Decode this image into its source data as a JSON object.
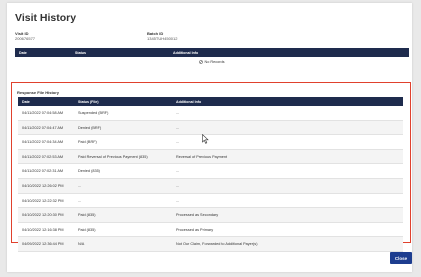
{
  "modal": {
    "title": "Visit History"
  },
  "meta": {
    "visit_id_label": "Visit ID",
    "visit_id": "200676577",
    "batch_id_label": "Batch ID",
    "batch_id": "1345TUH450012"
  },
  "top_table": {
    "columns": [
      "Date",
      "Status",
      "Additional Info"
    ],
    "empty_text": "No Records"
  },
  "response_history": {
    "title": "Response File History",
    "columns": [
      "Date",
      "Status (File)",
      "Additional Info"
    ],
    "rows": [
      {
        "date": "04/11/2022 07:04:58 AM",
        "status": "Suspended (BRF)",
        "info": "..."
      },
      {
        "date": "04/11/2022 07:04:47 AM",
        "status": "Denied (BRF)",
        "info": "..."
      },
      {
        "date": "04/11/2022 07:04:34 AM",
        "status": "Paid (BRF)",
        "info": "..."
      },
      {
        "date": "04/11/2022 07:02:53 AM",
        "status": "Paid Reversal of Previous Payment (835)",
        "info": "Reversal of Previous Payment"
      },
      {
        "date": "04/11/2022 07:02:31 AM",
        "status": "Denied (835)",
        "info": "..."
      },
      {
        "date": "04/10/2022 12:26:02 PM",
        "status": "...",
        "info": "..."
      },
      {
        "date": "04/10/2022 12:22:32 PM",
        "status": "...",
        "info": "..."
      },
      {
        "date": "04/10/2022 12:20:30 PM",
        "status": "Paid (835)",
        "info": "Processed as Secondary"
      },
      {
        "date": "04/10/2022 12:16:38 PM",
        "status": "Paid (835)",
        "info": "Processed as Primary"
      },
      {
        "date": "04/09/2022 12:36:44 PM",
        "status": "N/A",
        "info": "Not Our Claim, Forwarded to Additional Payer(s)"
      }
    ]
  },
  "footer": {
    "close_label": "Close"
  },
  "colors": {
    "header_bg": "#1e2b4d",
    "highlight_border": "#e0412d",
    "button_bg": "#1d3d8f"
  }
}
